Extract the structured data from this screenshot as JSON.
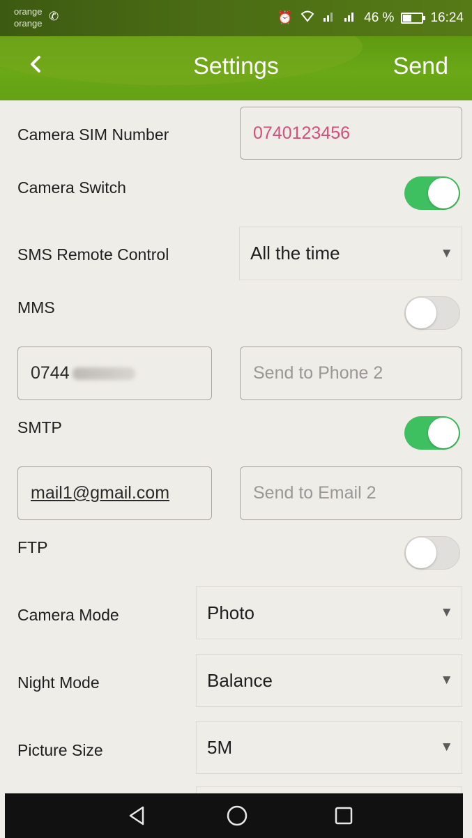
{
  "status_bar": {
    "carrier_line1": "orange",
    "carrier_line2": "orange",
    "battery_percent": "46 %",
    "time": "16:24",
    "icons": [
      "call-icon",
      "alarm-icon",
      "wifi-icon",
      "signal-icon",
      "signal-icon",
      "battery-icon"
    ]
  },
  "header": {
    "title": "Settings",
    "send_label": "Send",
    "back_icon": "chevron-left-icon"
  },
  "settings": {
    "camera_sim_label": "Camera SIM Number",
    "camera_sim_value": "0740123456",
    "camera_switch_label": "Camera Switch",
    "camera_switch_on": true,
    "sms_remote_label": "SMS Remote Control",
    "sms_remote_value": "All the time",
    "mms_label": "MMS",
    "mms_on": false,
    "phone1_value": "0744",
    "phone2_placeholder": "Send to Phone 2",
    "smtp_label": "SMTP",
    "smtp_on": true,
    "email1_value": "mail1@gmail.com",
    "email2_placeholder": "Send to Email 2",
    "ftp_label": "FTP",
    "ftp_on": false,
    "camera_mode_label": "Camera Mode",
    "camera_mode_value": "Photo",
    "night_mode_label": "Night Mode",
    "night_mode_value": "Balance",
    "picture_size_label": "Picture Size",
    "picture_size_value": "5M"
  },
  "colors": {
    "header_green": "#6aa817",
    "toggle_on": "#3fc060",
    "sim_number_pink": "#d24f7f",
    "background": "#efede7"
  }
}
